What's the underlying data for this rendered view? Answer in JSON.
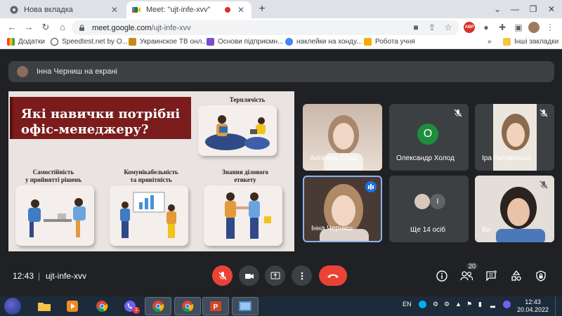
{
  "browser": {
    "tabs": [
      {
        "title": "Нова вкладка",
        "active": false
      },
      {
        "title": "Meet: \"ujt-infe-xvv\"",
        "active": true
      }
    ],
    "url_host": "meet.google.com",
    "url_path": "/ujt-infe-xvv",
    "bookmarks": [
      "Додатки",
      "Speedtest.net by O...",
      "Украинское ТВ онл...",
      "Основи підприємн...",
      "наклейки на хонду...",
      "Робота учня"
    ],
    "bookmarks_more": "»",
    "other_bookmarks": "Інші закладки"
  },
  "meet": {
    "presenting_text": "Інна Черниш на екрані",
    "slide": {
      "title_line1": "Які навички потрібні",
      "title_line2": "офіс-менеджеру?",
      "skill_patience": "Терплячість",
      "skill_independence_1": "Самостійність",
      "skill_independence_2": "у прийнятті рішень",
      "skill_communication_1": "Комунікабельність",
      "skill_communication_2": "та привітність",
      "skill_etiquette_1": "Знання ділового",
      "skill_etiquette_2": "етикету"
    },
    "participants": [
      {
        "name": "Ангеліна Соць",
        "muted": false
      },
      {
        "name": "Олександр Холод",
        "muted": true,
        "initial": "О",
        "avatar_color": "#1e8e3e"
      },
      {
        "name": "Іра Головенько",
        "muted": true
      },
      {
        "name": "Інна Черниш",
        "muted": false,
        "speaking": true
      },
      {
        "name": "Ще 14 осіб",
        "muted": false,
        "initial": "І"
      },
      {
        "name": "Ви",
        "muted": true
      }
    ],
    "time": "12:43",
    "separator": "|",
    "meeting_code": "ujt-infe-xvv",
    "participant_count": "20"
  },
  "taskbar": {
    "lang": "EN",
    "time": "12:43",
    "date": "20.04.2022",
    "viber_badge": "1"
  }
}
